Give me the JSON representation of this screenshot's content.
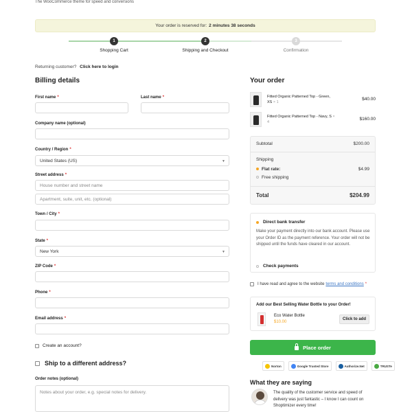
{
  "header": {
    "tagline": "The WooCommerce theme for speed and conversions"
  },
  "reservation": {
    "text": "Your order is reserved for:",
    "time": "2 minutes 38 seconds"
  },
  "steps": [
    {
      "num": "1",
      "label": "Shopping Cart"
    },
    {
      "num": "2",
      "label": "Shipping and Checkout"
    },
    {
      "num": "3",
      "label": "Confirmation"
    }
  ],
  "returning": {
    "text": "Returning customer?",
    "link": "Click here to login"
  },
  "billing": {
    "title": "Billing details",
    "first_name": "First name",
    "last_name": "Last name",
    "company": "Company name (optional)",
    "country_label": "Country / Region",
    "country_value": "United States (US)",
    "street_label": "Street address",
    "street_placeholder": "House number and street name",
    "street2_placeholder": "Apartment, suite, unit, etc. (optional)",
    "town_label": "Town / City",
    "state_label": "State",
    "state_value": "New York",
    "zip_label": "ZIP Code",
    "phone_label": "Phone",
    "email_label": "Email address",
    "create_account": "Create an account?",
    "required": "*"
  },
  "shipping": {
    "different_address": "Ship to a different address?"
  },
  "notes": {
    "label": "Order notes (optional)",
    "placeholder": "Notes about your order, e.g. special notes for delivery."
  },
  "order": {
    "title": "Your order",
    "items": [
      {
        "name": "Fitted Organic Patterned Top - Green, XS",
        "qty": "× 1",
        "price": "$40.00"
      },
      {
        "name": "Fitted Organic Patterned Top - Navy, S",
        "qty": "× 4",
        "price": "$160.00"
      }
    ],
    "subtotal_label": "Subtotal",
    "subtotal": "$200.00",
    "shipping_label": "Shipping",
    "flat_rate_label": "Flat rate:",
    "flat_rate": "$4.99",
    "free_shipping": "Free shipping",
    "total_label": "Total",
    "total": "$204.99"
  },
  "payment": {
    "bank": "Direct bank transfer",
    "bank_desc": "Make your payment directly into our bank account. Please use your Order ID as the payment reference. Your order will not be shipped until the funds have cleared in our account.",
    "check": "Check payments"
  },
  "terms": {
    "text": "I have read and agree to the website",
    "link": "terms and conditions",
    "required": "*"
  },
  "upsell": {
    "title": "Add our Best Selling Water Bottle to your Order!",
    "product": "Eco Water Bottle",
    "price": "$10.00",
    "button": "Click to add"
  },
  "place_order": {
    "label": "Place order"
  },
  "badges": [
    {
      "label": "Norton",
      "color": "#f5c400"
    },
    {
      "label": "Google Trusted Store",
      "color": "#4285f4"
    },
    {
      "label": "Authorize.Net",
      "color": "#1a5fa0"
    },
    {
      "label": "TRUSTe",
      "color": "#49a942"
    }
  ],
  "testimonials": {
    "title": "What they are saying",
    "quote": "The quality of the customer service and speed of delivery was just fantastic – I know I can count on Shoptimizer every time!"
  }
}
